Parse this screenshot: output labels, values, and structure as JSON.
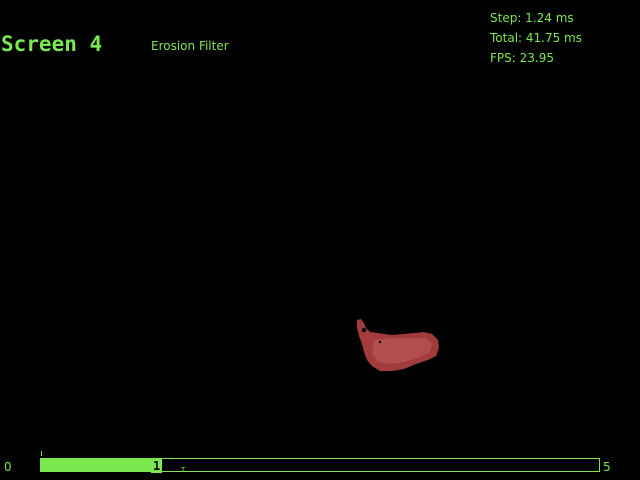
{
  "header": {
    "screen_title": "Screen 4",
    "filter_name": "Erosion Filter"
  },
  "stats": {
    "step": "Step: 1.24 ms",
    "total": "Total: 41.75 ms",
    "fps": "FPS: 23.95"
  },
  "timeline": {
    "min_label": "0",
    "max_label": "5",
    "current_label": "1",
    "progress_fraction": 0.2,
    "marker_label": "T"
  },
  "colors": {
    "accent": "#7CE84F",
    "background": "#000000",
    "blob": "#A23C3C"
  }
}
